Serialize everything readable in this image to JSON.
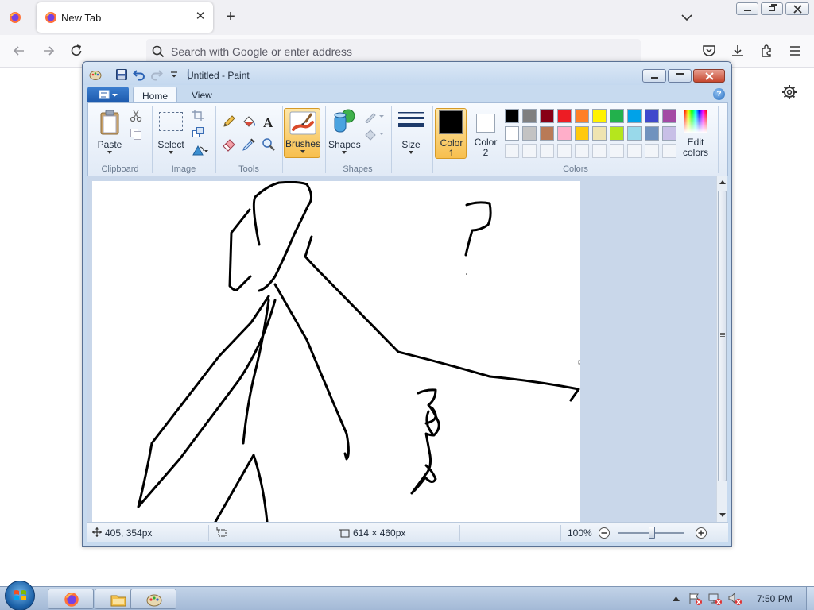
{
  "browser": {
    "tab_title": "New Tab",
    "address_placeholder": "Search with Google or enter address"
  },
  "paint": {
    "window_title": "Untitled - Paint",
    "tabs": [
      "Home",
      "View"
    ],
    "groups": {
      "clipboard": {
        "label": "Clipboard",
        "paste": "Paste"
      },
      "image": {
        "label": "Image",
        "select": "Select"
      },
      "tools": {
        "label": "Tools"
      },
      "brushes": {
        "label": "Brushes"
      },
      "shapes": {
        "label": "Shapes",
        "shapes_btn": "Shapes"
      },
      "size": {
        "label": "Size"
      },
      "colors": {
        "label": "Colors",
        "color1_line1": "Color",
        "color1_line2": "1",
        "color2_line1": "Color",
        "color2_line2": "2",
        "edit_line1": "Edit",
        "edit_line2": "colors",
        "color1_value": "#000000",
        "color2_value": "#ffffff",
        "palette_row1": [
          "#000000",
          "#7f7f7f",
          "#880015",
          "#ed1c24",
          "#ff7f27",
          "#fff200",
          "#22b14c",
          "#00a2e8",
          "#3f48cc",
          "#a349a4"
        ],
        "palette_row2": [
          "#ffffff",
          "#c3c3c3",
          "#b97a57",
          "#ffaec9",
          "#ffc90e",
          "#efe4b0",
          "#b5e61d",
          "#99d9ea",
          "#7092be",
          "#c8bfe7"
        ]
      }
    },
    "status": {
      "cursor_pos": "405, 354px",
      "canvas_size": "614 × 460px",
      "zoom": "100%"
    }
  },
  "taskbar": {
    "time": "7:50 PM"
  }
}
